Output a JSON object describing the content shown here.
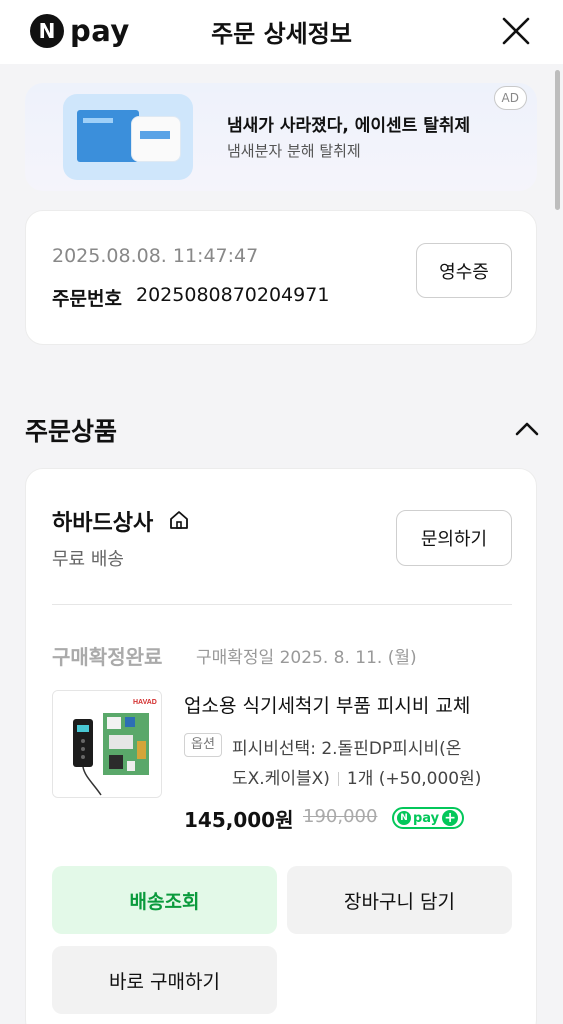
{
  "header": {
    "logo_n": "N",
    "logo_text": "pay",
    "title": "주문 상세정보"
  },
  "ad": {
    "badge": "AD",
    "title": "냄새가 사라졌다, 에이센트 탈취제",
    "subtitle": "냄새분자 분해 탈취제"
  },
  "order": {
    "datetime": "2025.08.08. 11:47:47",
    "number_label": "주문번호",
    "number": "2025080870204971",
    "receipt_label": "영수증"
  },
  "section": {
    "title": "주문상품"
  },
  "seller": {
    "name": "하바드상사",
    "shipping": "무료 배송",
    "inquiry_label": "문의하기"
  },
  "product": {
    "status": "구매확정완료",
    "confirm_date": "구매확정일 2025. 8. 11. (월)",
    "image_brand": "HAVAD",
    "name": "업소용 식기세척기 부품 피시비 교체",
    "option_badge": "옵션",
    "option_line1": "피시비선택: 2.돌핀DP피시비(온",
    "option_line2": "도X.케이블X)",
    "quantity": "1개 (+50,000원)",
    "price": "145,000원",
    "original_price": "190,000",
    "npay_plus_label": "pay"
  },
  "actions": {
    "track_label": "배송조회",
    "cart_label": "장바구니 담기",
    "buy_label": "바로 구매하기"
  },
  "colors": {
    "accent_green": "#03c75a",
    "track_bg": "#e3f9e8",
    "track_text": "#0a9a3c"
  }
}
